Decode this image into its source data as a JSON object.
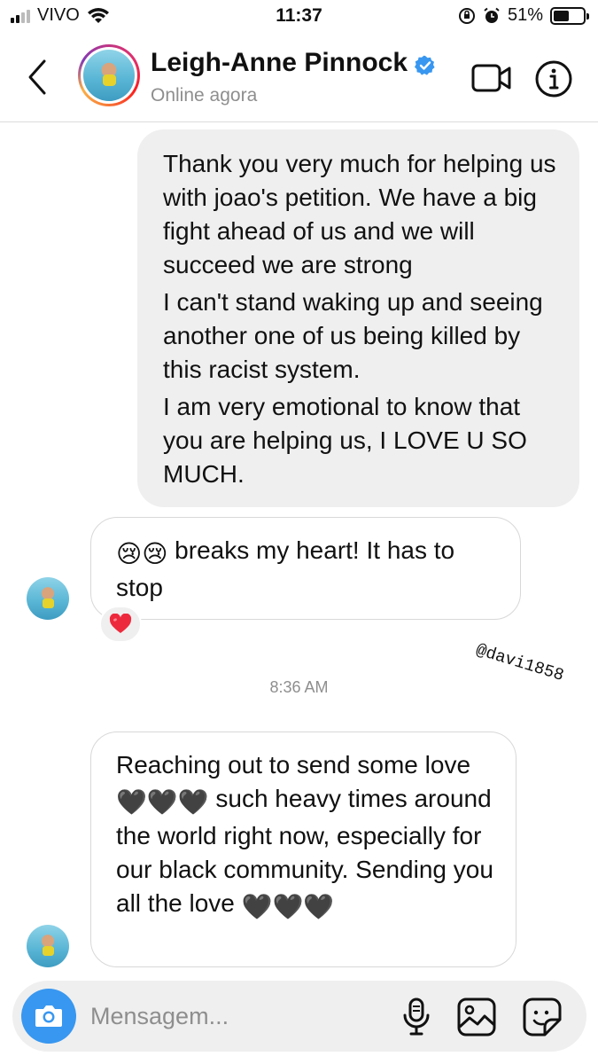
{
  "status_bar": {
    "carrier": "VIVO",
    "time": "11:37",
    "battery_percent": "51%",
    "battery_level": 0.51
  },
  "header": {
    "contact_name": "Leigh-Anne Pinnock",
    "status": "Online agora",
    "verified": true
  },
  "messages": {
    "outgoing_1": {
      "paragraphs": [
        "Thank you very much for helping us with joao's petition. We have a big fight ahead of us and we will succeed we are strong",
        "I can't stand waking up and seeing another one of us being killed by this racist system.",
        "I am very emotional to know that you are helping us, I LOVE U SO MUCH."
      ]
    },
    "incoming_1": {
      "emoji": "😢😢",
      "text": "breaks my heart! It has to stop",
      "reaction": "❤️"
    },
    "timestamp": "8:36 AM",
    "incoming_2": {
      "text_a": "Reaching out to send some love",
      "emoji_a": "🖤🖤🖤",
      "text_b": "such heavy times around the world right now, especially for our black community. Sending you all the love",
      "emoji_b": "🖤🖤🖤"
    }
  },
  "watermark": "@davi1858",
  "composer": {
    "placeholder": "Mensagem..."
  },
  "icons": {
    "accent": "#3897f0",
    "verified_color": "#3897f0",
    "heart_color": "#ed2a3d"
  }
}
